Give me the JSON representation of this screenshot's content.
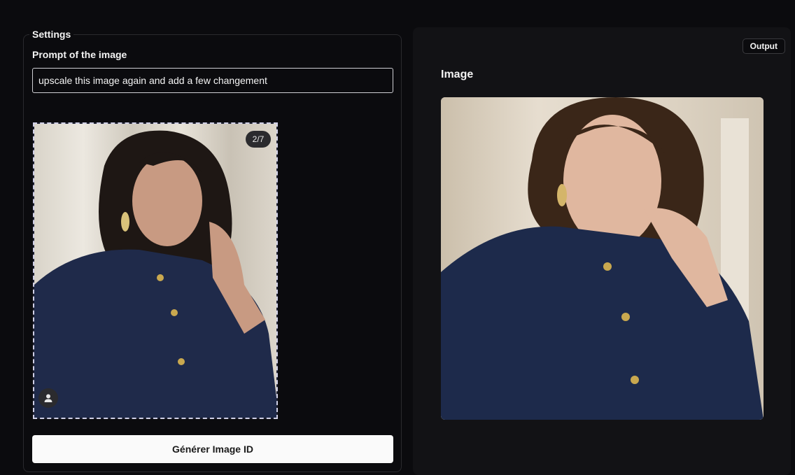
{
  "settings": {
    "legend": "Settings",
    "prompt_label": "Prompt of the image",
    "prompt_value": "upscale this image again and add a few changement",
    "gallery_counter": "2/7",
    "generate_label": "Générer Image ID"
  },
  "output": {
    "badge": "Output",
    "title": "Image"
  },
  "icons": {
    "avatar": "user-icon"
  }
}
